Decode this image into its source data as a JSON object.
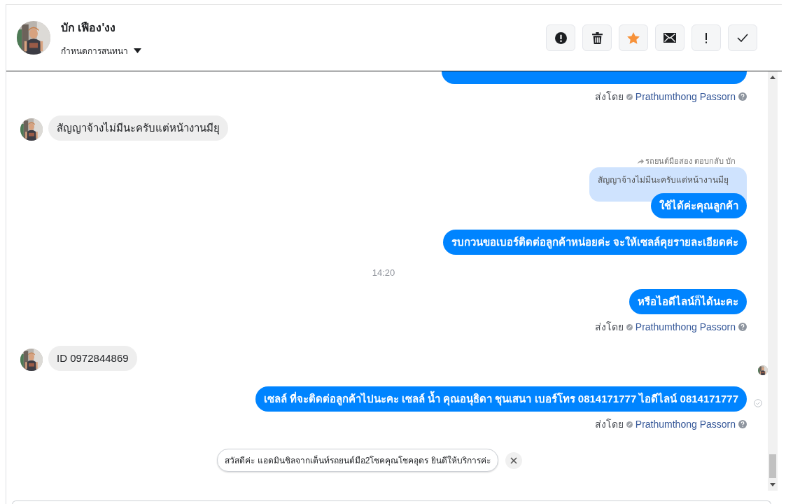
{
  "header": {
    "name": "บัก เฟือง'งง",
    "subtitle": "กำหนดการสนทนา",
    "actions": [
      {
        "kind": "alert"
      },
      {
        "kind": "delete"
      },
      {
        "kind": "star",
        "on": true
      },
      {
        "kind": "mail"
      },
      {
        "kind": "important"
      },
      {
        "kind": "done"
      }
    ]
  },
  "messages": [
    {
      "kind": "clipped"
    },
    {
      "kind": "sent_by",
      "label": "ส่งโดย",
      "sender": "Prathumthong Passorn"
    },
    {
      "kind": "incoming",
      "text": "สัญญาจ้างไม่มีนะครับแต่หน้างานมียุ"
    },
    {
      "kind": "reply",
      "header": "รถยนต์มือสอง ตอบกลับ บัก",
      "quoted": "สัญญาจ้างไม่มีนะครับแต่หน้างานมียุ",
      "text": "ใช้ได้ค่ะคุณลูกค้า"
    },
    {
      "kind": "outgoing",
      "text": "รบกวนขอเบอร์ติดต่อลูกค้าหน่อยค่ะ จะให้เซลล์คุยรายละเอียดค่ะ"
    },
    {
      "kind": "time",
      "text": "14:20"
    },
    {
      "kind": "outgoing",
      "text": "หรือไอดีไลน์ก็ได้นะคะ"
    },
    {
      "kind": "sent_by",
      "label": "ส่งโดย",
      "sender": "Prathumthong Passorn"
    },
    {
      "kind": "incoming",
      "text": "ID 0972844869"
    },
    {
      "kind": "seen"
    },
    {
      "kind": "outgoing",
      "text": "เซลล์ ที่จะติดต่อลูกค้าไปนะคะ เซลล์ น้ำ คุณอนุธิดา ชุนเสนา เบอร์โทร 0814171777 ไอดีไลน์ 0814171777",
      "delivered": true
    },
    {
      "kind": "sent_by",
      "label": "ส่งโดย",
      "sender": "Prathumthong Passorn"
    }
  ],
  "suggestion": {
    "text": "สวัสดีค่ะ แอดมินชิลจากเต็นท์รถยนต์มือ2โชคคุณโชคอุดร ยินดีให้บริการค่ะ"
  }
}
